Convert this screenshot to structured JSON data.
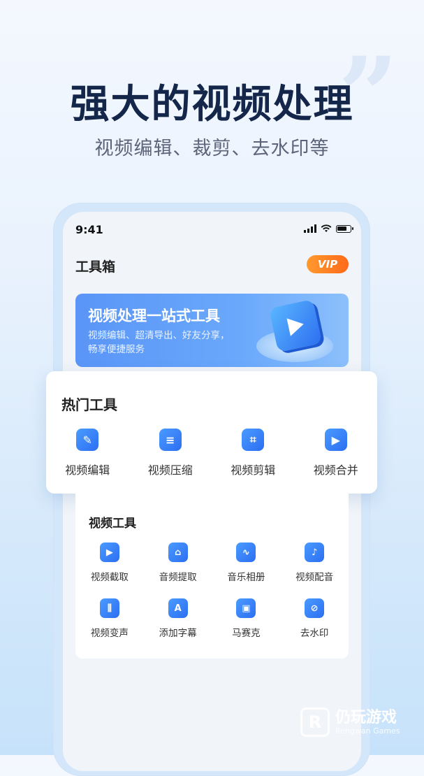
{
  "hero": {
    "title": "强大的视频处理",
    "subtitle": "视频编辑、裁剪、去水印等"
  },
  "status_bar": {
    "time": "9:41"
  },
  "toolbox": {
    "title": "工具箱",
    "vip_label": "VIP"
  },
  "banner": {
    "title": "视频处理一站式工具",
    "description": "视频编辑、超清导出、好友分享，畅享便捷服务"
  },
  "hot_tools": {
    "title": "热门工具",
    "items": [
      {
        "label": "视频编辑",
        "icon": "edit-pen-icon"
      },
      {
        "label": "视频压缩",
        "icon": "compress-icon"
      },
      {
        "label": "视频剪辑",
        "icon": "crop-icon"
      },
      {
        "label": "视频合并",
        "icon": "merge-play-icon"
      }
    ]
  },
  "video_tools": {
    "title": "视频工具",
    "items": [
      {
        "label": "视频截取",
        "icon": "trim-play-icon"
      },
      {
        "label": "音频提取",
        "icon": "home-audio-icon"
      },
      {
        "label": "音乐相册",
        "icon": "album-wave-icon"
      },
      {
        "label": "视频配音",
        "icon": "microphone-icon"
      },
      {
        "label": "视频变声",
        "icon": "voice-wave-icon"
      },
      {
        "label": "添加字幕",
        "icon": "subtitle-icon"
      },
      {
        "label": "马赛克",
        "icon": "mosaic-icon"
      },
      {
        "label": "去水印",
        "icon": "remove-watermark-icon"
      }
    ]
  },
  "watermark": {
    "name": "仍玩游戏",
    "sub": "Rengwan Games"
  },
  "colors": {
    "accent": "#2c6ef2",
    "vip_orange": "#ff7a20",
    "title_navy": "#14264a"
  }
}
